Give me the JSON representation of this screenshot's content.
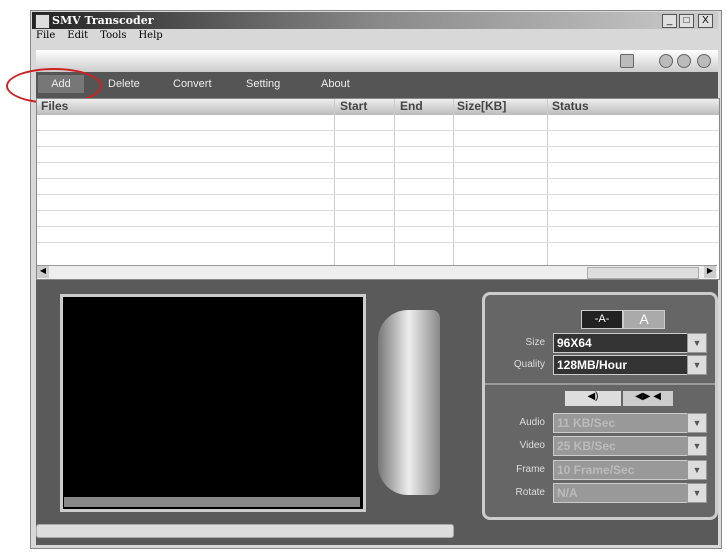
{
  "window": {
    "title": "SMV Transcoder",
    "controls": [
      "_",
      "□",
      "X"
    ]
  },
  "menu": [
    "File",
    "Edit",
    "Tools",
    "Help"
  ],
  "toolbar": [
    "Add",
    "Delete",
    "Convert",
    "Setting",
    "About"
  ],
  "table": {
    "columns": [
      "Files",
      "Start",
      "End",
      "Size[KB]",
      "Status"
    ],
    "rows": []
  },
  "settings": {
    "size_label": "Size",
    "size": "96X64",
    "quality_label": "Quality",
    "quality": "128MB/Hour",
    "audio_label": "Audio",
    "audio": "11 KB/Sec",
    "video_label": "Video",
    "video": "25 KB/Sec",
    "frame_label": "Frame",
    "frame": "10 Frame/Sec",
    "rotate_label": "Rotate",
    "rotate": "N/A",
    "font_buttons": [
      "-A-",
      "A"
    ]
  }
}
